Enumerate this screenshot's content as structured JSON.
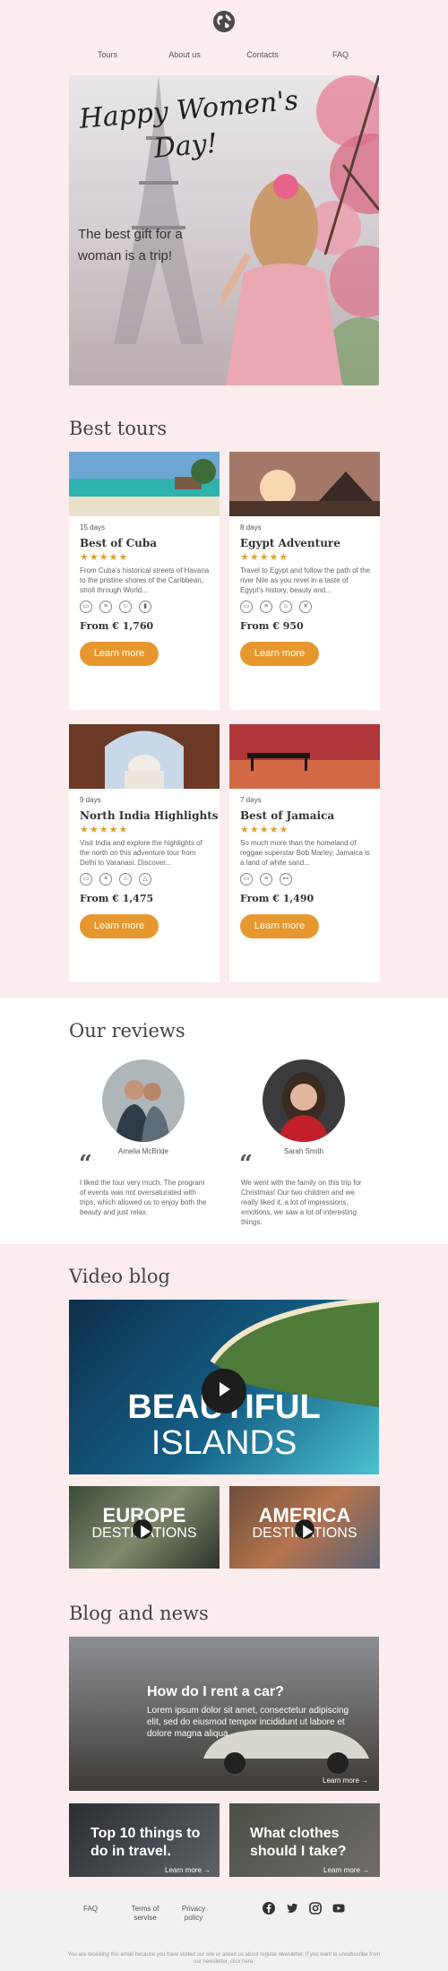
{
  "nav": {
    "items": [
      "Tours",
      "About us",
      "Contacts",
      "FAQ"
    ]
  },
  "hero": {
    "title_line1": "Happy Women's",
    "title_line2": "Day!",
    "subtitle": "The best gift for a woman is a trip!"
  },
  "best_tours": {
    "title": "Best tours",
    "tours": [
      {
        "days": "15 days",
        "name": "Best of Cuba",
        "stars": "★★★★★",
        "desc": "From Cuba's historical streets of Havana to the pristine shores of the Caribbean, stroll through World...",
        "price": "From € 1,760",
        "button": "Learn more"
      },
      {
        "days": "8 days",
        "name": "Egypt Adventure",
        "stars": "★★★★★",
        "desc": "Travel to Egypt and follow the path of the river Nile as you revel in a taste of Egypt's history, beauty and...",
        "price": "From € 950",
        "button": "Learn more"
      },
      {
        "days": "9 days",
        "name": "North India Highlights",
        "stars": "★★★★★",
        "desc": "Visit India and explore the highlights of the north on this adventure tour from Delhi to Varanasi. Discover...",
        "price": "From € 1,475",
        "button": "Learn more"
      },
      {
        "days": "7 days",
        "name": "Best of Jamaica",
        "stars": "★★★★★",
        "desc": "So much more than the homeland of reggae superstar Bob Marley, Jamaica is a land of white sand...",
        "price": "From € 1,490",
        "button": "Learn more"
      }
    ]
  },
  "reviews": {
    "title": "Our reviews",
    "items": [
      {
        "name": "Amelia McBride",
        "quote_mark": "“",
        "text": "I liked the tour very much. The program of events was not oversaturated with trips, which allowed us to enjoy both the beauty and just relax."
      },
      {
        "name": "Sarah Smith",
        "quote_mark": "“",
        "text": "We went with the family on this trip for Christmas! Our two children and we really liked it, a lot of impressions, emotions, we saw a lot of interesting things."
      }
    ]
  },
  "video_blog": {
    "title": "Video blog",
    "main": {
      "line1": "BEAUTIFUL",
      "line2": "ISLANDS"
    },
    "small": [
      {
        "line1": "EUROPE",
        "line2": "DESTINATIONS"
      },
      {
        "line1": "AMERICA",
        "line2": "DESTINATIONS"
      }
    ]
  },
  "blog": {
    "title": "Blog and news",
    "main": {
      "heading": "How do I rent a car?",
      "text": "Lorem ipsum dolor sit amet, consectetur adipiscing elit, sed do eiusmod tempor incididunt ut labore et dolore magna aliqua",
      "more": "Learn more →"
    },
    "small": [
      {
        "heading": "Top 10 things to do in travel.",
        "more": "Learn more →"
      },
      {
        "heading": "What clothes should I take?",
        "more": "Learn more →"
      }
    ]
  },
  "footer": {
    "links": [
      "FAQ",
      "Terms of servise",
      "Privacy policy"
    ],
    "social": [
      "facebook-icon",
      "twitter-icon",
      "instagram-icon",
      "youtube-icon"
    ],
    "legal": "You are receiving this email because you have visited our site or asked us about regular newsletter. If you want to unsubscribe from our newsletter, click here."
  }
}
